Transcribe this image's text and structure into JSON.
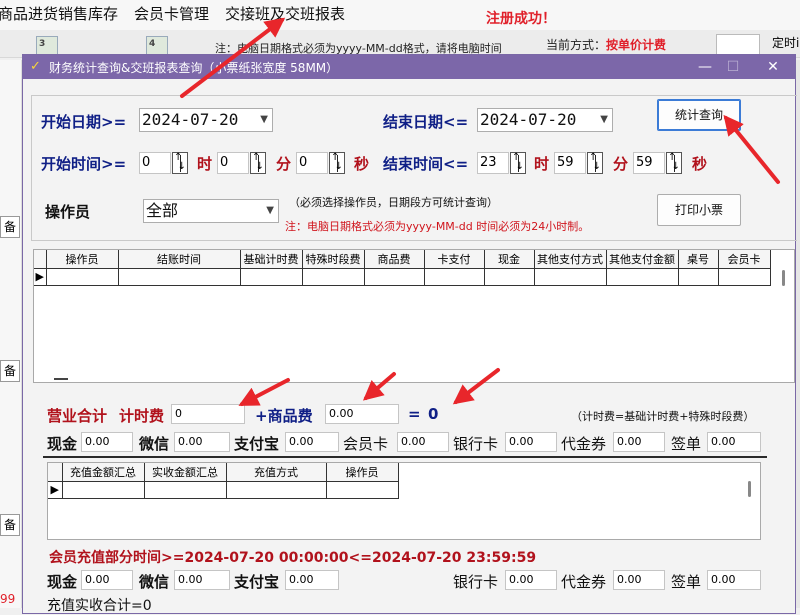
{
  "app": {
    "menu": [
      "商品进货销售库存",
      "会员卡管理",
      "交接班及交班报表"
    ],
    "register_status": "注册成功！",
    "bg_note": "注：电脑日期格式必须为yyyy-MM-dd格式，请将电脑时间",
    "bg_billing_label": "当前方式：",
    "bg_billing_value": "按单价计费",
    "bg_timer": "定时i",
    "bg_side_btn": "备"
  },
  "dialog": {
    "title": "财务统计查询&交班报表查询（小票纸张宽度 58MM）",
    "controls": {
      "minimize": "—",
      "maximize": "☐",
      "close": "✕"
    },
    "start_date_label": "开始日期>=",
    "start_date_value": "2024-07-20",
    "end_date_label": "结束日期<=",
    "end_date_value": "2024-07-20",
    "query_button": "统计查询",
    "start_time_label": "开始时间>=",
    "start_time": {
      "hour": "0",
      "minute": "0",
      "second": "0"
    },
    "end_time_label": "结束时间<=",
    "end_time": {
      "hour": "23",
      "minute": "59",
      "second": "59"
    },
    "unit_hour": "时",
    "unit_minute": "分",
    "unit_second": "秒",
    "operator_label": "操作员",
    "operator_value": "全部",
    "operator_hint": "（必须选择操作员，日期段方可统计查询）",
    "date_format_note": "注：电脑日期格式必须为yyyy-MM-dd 时间必须为24小时制。",
    "print_button": "打印小票",
    "main_table_headers": [
      "操作员",
      "结账时间",
      "基础计时费",
      "特殊时段费",
      "商品费",
      "卡支付",
      "现金",
      "其他支付方式",
      "其他支付金额",
      "桌号",
      "会员卡"
    ],
    "revenue_label": "营业合计",
    "time_fee_label": "计时费",
    "time_fee_value": "0",
    "goods_fee_label": "+商品费",
    "goods_fee_value": "0.00",
    "equals": "=",
    "total_value": "0",
    "formula_note": "（计时费=基础计时费+特殊时段费）",
    "payments": {
      "cash_label": "现金",
      "cash": "0.00",
      "wechat_label": "微信",
      "wechat": "0.00",
      "alipay_label": "支付宝",
      "alipay": "0.00",
      "member_label": "会员卡",
      "member": "0.00",
      "bank_label": "银行卡",
      "bank": "0.00",
      "voucher_label": "代金券",
      "voucher": "0.00",
      "sign_label": "签单",
      "sign": "0.00"
    },
    "recharge_table_headers": [
      "充值金额汇总",
      "实收金额汇总",
      "充值方式",
      "操作员"
    ],
    "recharge_period": "会员充值部分时间>=2024-07-20 00:00:00<=2024-07-20 23:59:59",
    "recharge_payments": {
      "cash_label": "现金",
      "cash": "0.00",
      "wechat_label": "微信",
      "wechat": "0.00",
      "alipay_label": "支付宝",
      "alipay": "0.00",
      "bank_label": "银行卡",
      "bank": "0.00",
      "voucher_label": "代金券",
      "voucher": "0.00",
      "sign_label": "签单",
      "sign": "0.00"
    },
    "recharge_total_label": "充值实收合计=",
    "recharge_total_value": "0"
  },
  "colors": {
    "titlebar": "#7c67a9",
    "label_blue": "#0f1f86",
    "label_red": "#b1121c",
    "annotation": "#e8262b"
  }
}
